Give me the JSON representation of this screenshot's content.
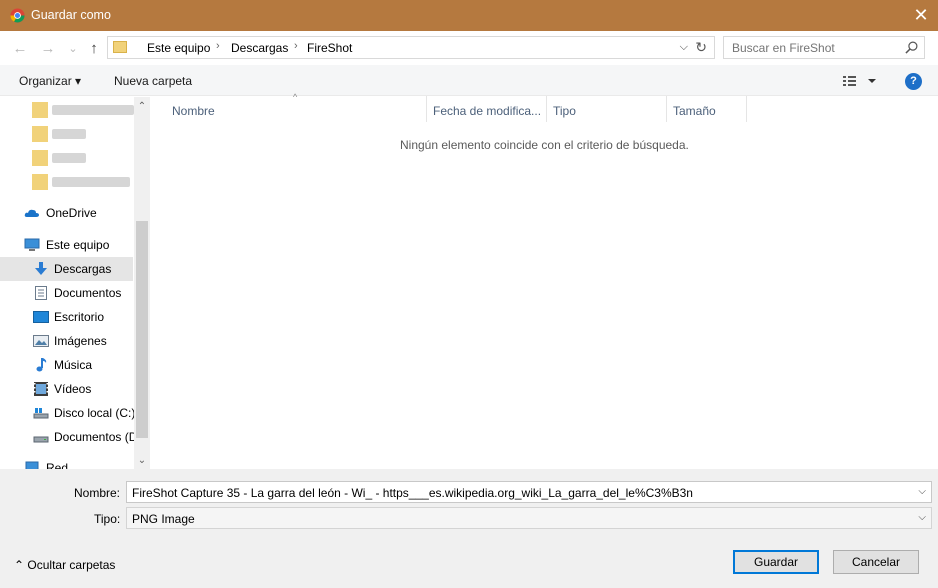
{
  "window": {
    "title": "Guardar como",
    "close_glyph": "✕"
  },
  "navigation": {
    "back_glyph": "←",
    "forward_glyph": "→",
    "recent_glyph": "⌄",
    "up_glyph": "↑"
  },
  "address_bar": {
    "breadcrumbs": [
      "Este equipo",
      "Descargas",
      "FireShot"
    ],
    "separator": "›",
    "dropdown_glyph": "⌵",
    "refresh_glyph": "↻"
  },
  "search": {
    "placeholder": "Buscar en FireShot"
  },
  "toolbar": {
    "organize_label": "Organizar ▾",
    "new_folder_label": "Nueva carpeta",
    "help_label": "?"
  },
  "nav_pane": {
    "onedrive": "OneDrive",
    "this_pc": "Este equipo",
    "items": [
      {
        "label": "Descargas",
        "icon": "download-icon"
      },
      {
        "label": "Documentos",
        "icon": "documents-icon"
      },
      {
        "label": "Escritorio",
        "icon": "desktop-icon"
      },
      {
        "label": "Imágenes",
        "icon": "pictures-icon"
      },
      {
        "label": "Música",
        "icon": "music-icon"
      },
      {
        "label": "Vídeos",
        "icon": "videos-icon"
      },
      {
        "label": "Disco local (C:)",
        "icon": "drive-icon"
      },
      {
        "label": "Documentos (D",
        "icon": "drive-icon"
      }
    ],
    "network": "Red",
    "scroll_up_glyph": "⌃",
    "scroll_down_glyph": "⌄"
  },
  "file_list": {
    "columns": [
      "Nombre",
      "Fecha de modifica...",
      "Tipo",
      "Tamaño"
    ],
    "sort_glyph": "^",
    "empty_message": "Ningún elemento coincide con el criterio de búsqueda."
  },
  "save_form": {
    "name_label": "Nombre:",
    "name_value": "FireShot Capture 35 - La garra del león - Wi_ - https___es.wikipedia.org_wiki_La_garra_del_le%C3%B3n",
    "type_label": "Tipo:",
    "type_value": "PNG Image",
    "dropdown_glyph": "⌵"
  },
  "footer": {
    "hide_folders_label": "⌃  Ocultar carpetas",
    "save_button": "Guardar",
    "cancel_button": "Cancelar"
  },
  "colors": {
    "titlebar": "#b5793f",
    "accent": "#0078d7",
    "folder": "#f1d27a"
  }
}
